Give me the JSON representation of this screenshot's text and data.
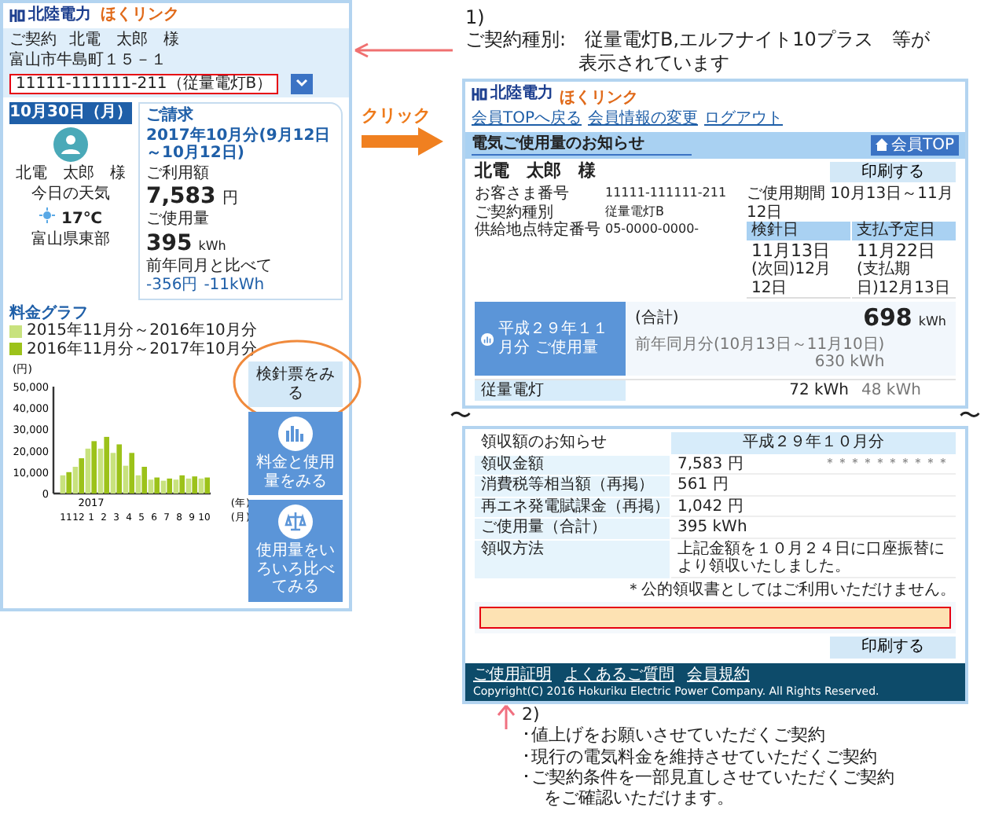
{
  "home_screen": {
    "logo": "北陸電力",
    "service_logo": "ほくリンク",
    "contract_bar": {
      "label": "ご契約",
      "name": "北電　太郎　様",
      "address": "富山市牛島町１５－１",
      "contract": "11111-111111-211（従量電灯B）"
    },
    "date": "10月30日（月）",
    "user_name": "北電　太郎　様",
    "weather": {
      "label": "今日の天気",
      "temperature": "17℃",
      "area": "富山県東部"
    },
    "bill": {
      "title": "ご請求",
      "period": "2017年10月分(9月12日～10月12日)",
      "amount_label": "ご利用額",
      "amount": "7,583",
      "amount_unit": "円",
      "usage_label": "ご使用量",
      "usage": "395",
      "usage_unit": "kWh",
      "compare_label": "前年同月と比べて",
      "amount_diff": "-356円",
      "usage_diff": "-11kWh"
    },
    "chart_title": "料金グラフ",
    "chart_data": {
      "type": "bar",
      "ylabel": "(円)",
      "categories": [
        "11",
        "12",
        "1",
        "2",
        "3",
        "4",
        "5",
        "6",
        "7",
        "8",
        "9",
        "10"
      ],
      "series": [
        {
          "name": "2015年11月分～2016年10月分",
          "color": "#c8e27e",
          "values": [
            8500,
            12500,
            21000,
            21000,
            19000,
            13000,
            8500,
            6500,
            6000,
            6500,
            7000,
            7000
          ]
        },
        {
          "name": "2016年11月分～2017年10月分",
          "color": "#9cc21a",
          "values": [
            10000,
            16500,
            24500,
            26500,
            23000,
            19000,
            12500,
            7500,
            7000,
            8500,
            8000,
            7500
          ]
        }
      ],
      "ylim": [
        0,
        50000
      ],
      "yticks": [
        {
          "value": 0,
          "label": "0"
        },
        {
          "value": 10000,
          "label": "10,000"
        },
        {
          "value": 20000,
          "label": "20,000"
        },
        {
          "value": 30000,
          "label": "30,000"
        },
        {
          "value": 40000,
          "label": "40,000"
        },
        {
          "value": 50000,
          "label": "50,000"
        }
      ],
      "annotations": [
        "2017",
        "(年)",
        "(月)"
      ]
    },
    "buttons": [
      {
        "label": "検針票をみる",
        "kind": "plain",
        "circled": true
      },
      {
        "label": "料金と使用量をみる",
        "kind": "chart",
        "circled": false
      },
      {
        "label": "使用量をいろいろ比べてみる",
        "kind": "scale",
        "circled": false
      }
    ]
  },
  "note_1": {
    "number": "1)",
    "lines": [
      "ご契約種別:　従量電灯B,エルフナイト10プラス　等が",
      "表示されています"
    ]
  },
  "click_label": "クリック",
  "notice_screen": {
    "logo": "北陸電力",
    "service_logo": "ほくリンク",
    "nav": [
      "会員TOPへ戻る",
      "会員情報の変更",
      "ログアウト"
    ],
    "title": "電気ご使用量のお知らせ",
    "top_button": "会員TOP",
    "print_button": "印刷する",
    "customer": "北電　太郎　様",
    "fields": [
      {
        "label": "お客さま番号",
        "value": "11111-111111-211"
      },
      {
        "label": "ご契約種別",
        "value": "従量電灯B"
      },
      {
        "label": "供給地点特定番号",
        "value": "05-0000-0000-"
      }
    ],
    "period": "ご使用期間 10月13日～11月12日",
    "dates": [
      {
        "label": "検針日",
        "date": "11月13日",
        "sub": "(次回)12月12日"
      },
      {
        "label": "支払予定日",
        "date": "11月22日",
        "sub": "(支払期日)12月13日"
      }
    ],
    "usage": {
      "title": "平成２９年１１月分 ご使用量",
      "total_label": "(合計)",
      "value": "698",
      "unit": "kWh",
      "prev_label": "前年同月分(10月13日～11月10日)",
      "prev_value": "630 kWh"
    },
    "usage_rows": [
      {
        "label": "従量電灯",
        "value": "72 kWh",
        "prev": "48 kWh"
      }
    ]
  },
  "receipt_screen": {
    "title": "領収額のお知らせ",
    "column": "平成２９年１０月分",
    "rows": [
      {
        "label": "領収金額",
        "value": "7,583 円",
        "extra": "＊＊＊＊＊＊＊＊＊＊"
      },
      {
        "label": "消費税等相当額（再掲）",
        "value": "561 円"
      },
      {
        "label": "再エネ発電賦課金（再掲）",
        "value": "1,042 円"
      },
      {
        "label": "ご使用量（合計）",
        "value": "395 kWh"
      },
      {
        "label": "領収方法",
        "value": "上記金額を１０月２４日に口座振替により領収いたしました。"
      }
    ],
    "note": "＊公的領収書としてはご利用いただけません。",
    "print_button": "印刷する",
    "footer_links": [
      "ご使用証明",
      "よくあるご質問",
      "会員規約"
    ],
    "copyright": "Copyright(C) 2016 Hokuriku Electric Power Company. All Rights Reserved."
  },
  "break_marks": [
    "〜",
    "〜"
  ],
  "note_2": {
    "number": "2)",
    "lines": [
      "･値上げをお願いさせていただくご契約",
      "･現行の電気料金を維持させていただくご契約",
      "･ご契約条件を一部見直しさせていただくご契約",
      "をご確認いただけます。"
    ]
  }
}
